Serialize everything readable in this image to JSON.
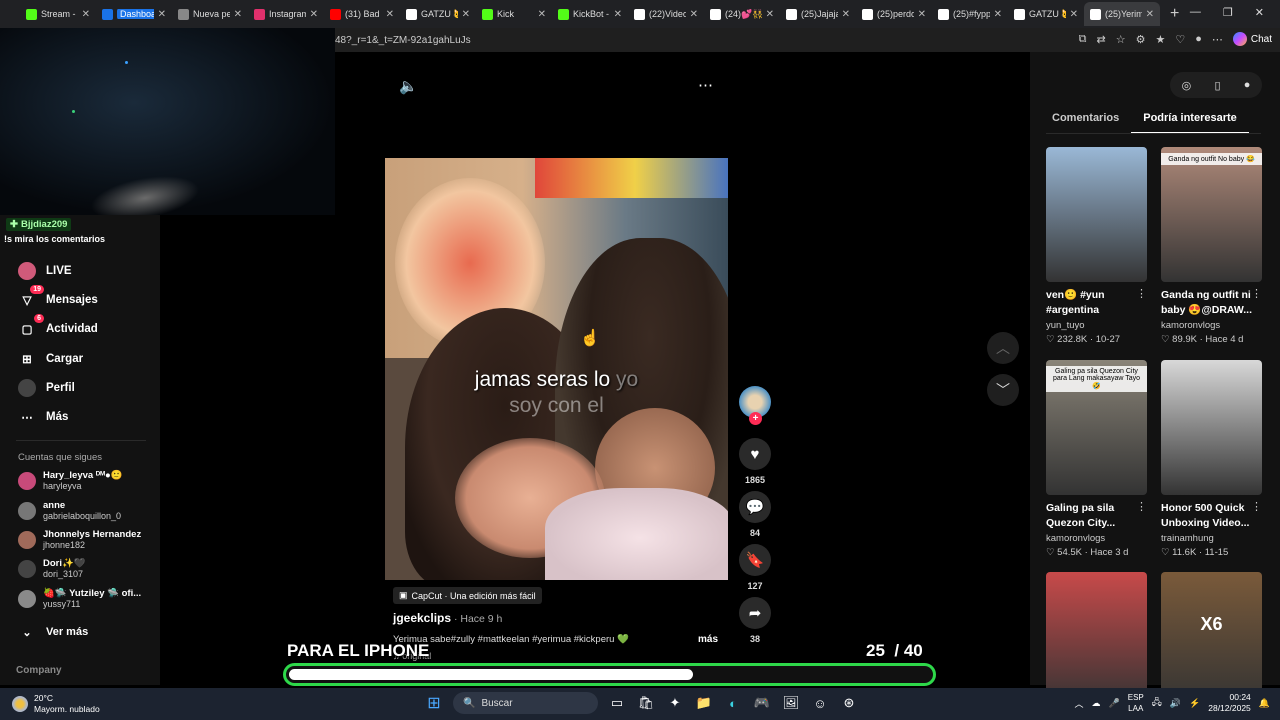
{
  "browser": {
    "tabs": [
      {
        "title": "Stream - K",
        "color": "#53fc18"
      },
      {
        "title": "Dashboard",
        "color": "#1a73e8",
        "badge": true
      },
      {
        "title": "Nueva pe",
        "color": "#888888"
      },
      {
        "title": "Instagram",
        "color": "#e1306c"
      },
      {
        "title": "(31) Bad B",
        "color": "#ff0000"
      },
      {
        "title": "GATZU 🐱",
        "color": "#ffffff"
      },
      {
        "title": "Kick",
        "color": "#53fc18"
      },
      {
        "title": "KickBot - K",
        "color": "#53fc18"
      },
      {
        "title": "(22)Video",
        "color": "#ffffff"
      },
      {
        "title": "(24)💕👯",
        "color": "#ffffff"
      },
      {
        "title": "(25)Jajaja",
        "color": "#ffffff"
      },
      {
        "title": "(25)perdo",
        "color": "#ffffff"
      },
      {
        "title": "(25)#fypp",
        "color": "#ffffff"
      },
      {
        "title": "GATZU 🐱",
        "color": "#ffffff"
      },
      {
        "title": "(25)Yerim",
        "color": "#ffffff",
        "active": true
      }
    ],
    "url": "48?_r=1&_t=ZM-92a1gahLuJs",
    "chat_label": "Chat"
  },
  "stream_chat": {
    "username": "Bjjdiaz209",
    "message": "!s mira los comentarios"
  },
  "sidebar": {
    "nav": [
      {
        "label": "LIVE",
        "icon": "live-icon"
      },
      {
        "label": "Mensajes",
        "icon": "messages-icon",
        "badge": "19"
      },
      {
        "label": "Actividad",
        "icon": "activity-icon",
        "badge": "6"
      },
      {
        "label": "Cargar",
        "icon": "upload-icon"
      },
      {
        "label": "Perfil",
        "icon": "profile-icon"
      },
      {
        "label": "Más",
        "icon": "more-icon"
      }
    ],
    "following_title": "Cuentas que sigues",
    "following": [
      {
        "name": "Hary_leyva ᴰᴹ●🙂",
        "user": "haryleyva",
        "color": "#c84a7a"
      },
      {
        "name": "anne",
        "user": "gabrielaboquillon_0",
        "color": "#777777"
      },
      {
        "name": "Jhonnelys Hernandez",
        "user": "jhonne182",
        "color": "#a06a5a"
      },
      {
        "name": "Dori✨🖤",
        "user": "dori_3107",
        "color": "#444444"
      },
      {
        "name": "🍓🛸 Yutziley 🛸 ofi...",
        "user": "yussy711",
        "color": "#8a8a8a"
      }
    ],
    "see_more": "Ver más",
    "company": "Company"
  },
  "video": {
    "caption_line1_main": "jamas seras lo",
    "caption_line1_dim": "yo",
    "caption_line2": "soy con el",
    "capcut": "CapCut · Una edición más fácil",
    "author": "jgeekclips",
    "time": " · Hace 9 h",
    "description": "Yerimua sabe#zully #mattkeelan #yerimua #kickperu 💚",
    "more": "más",
    "sound": "♫ original",
    "likes": "1865",
    "comments": "84",
    "saves": "127",
    "shares": "38"
  },
  "overlay": {
    "label": "PARA EL IPHONE",
    "current": "25",
    "total": "/ 40",
    "progress": 0.63
  },
  "right_panel": {
    "tabs": [
      "Comentarios",
      "Podría interesarte"
    ],
    "cards": [
      {
        "title": "ven🙂 #yun #argentina",
        "user": "yun_tuyo",
        "stats": "♡ 232.8K · 10-27",
        "bg": "#9ab8d6"
      },
      {
        "title": "Ganda ng outfit ni baby 😍@DRAW...",
        "user": "kamoronvlogs",
        "stats": "♡ 89.9K · Hace 4 d",
        "bg": "#b08a7a",
        "thumb_text": "Ganda ng outfit No baby 😂"
      },
      {
        "title": "Galing pa sila Quezon City...",
        "user": "kamoronvlogs",
        "stats": "♡ 54.5K · Hace 3 d",
        "bg": "#8a8478",
        "thumb_text": "Galing pa sila Quezon City para Lang makasayaw Tayo 🤣"
      },
      {
        "title": "Honor 500 Quick Unboxing Video...",
        "user": "trainamhung",
        "stats": "♡ 11.6K · 11-15",
        "bg": "#d8d8d8"
      },
      {
        "title": "",
        "user": "",
        "stats": "",
        "bg": "#c84a4a"
      },
      {
        "title": "",
        "user": "",
        "stats": "",
        "bg": "#7a5a3a",
        "thumb_text": "X6"
      }
    ]
  },
  "taskbar": {
    "temp": "20°C",
    "weather": "Mayorm. nublado",
    "search": "Buscar",
    "lang1": "ESP",
    "lang2": "LAA",
    "time": "00:24",
    "date": "28/12/2025"
  }
}
